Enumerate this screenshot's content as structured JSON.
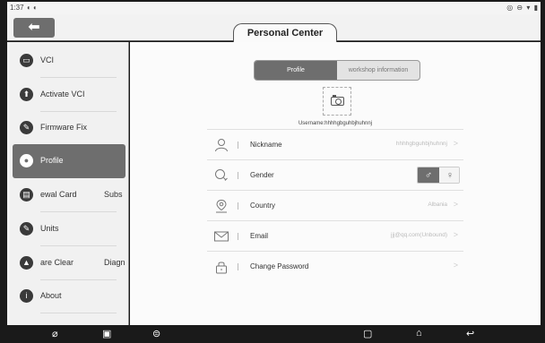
{
  "status": {
    "time": "1:37",
    "left_icons": "◐ ◐",
    "right_icons": "◎ ⊖ ▾ ▮"
  },
  "header": {
    "back_icon": "⬅",
    "title": "Personal Center"
  },
  "sidebar": {
    "items": [
      {
        "label": "VCI",
        "icon": "▭"
      },
      {
        "label": "Activate VCI",
        "icon": "⬆"
      },
      {
        "label": "Firmware Fix",
        "icon": "✎"
      },
      {
        "label": "Profile",
        "icon": "●"
      },
      {
        "label": "ewal Card",
        "label2": "Subs",
        "icon": "▤"
      },
      {
        "label": "Units",
        "icon": "✎"
      },
      {
        "label": "are Clear",
        "label2": "Diagn",
        "icon": "▲"
      },
      {
        "label": "About",
        "icon": "i"
      }
    ]
  },
  "tabs": {
    "profile": "Profile",
    "workshop": "workshop information"
  },
  "username": "Username:hhhhgbguhbjhuhnnj",
  "rows": [
    {
      "label": "Nickname",
      "value": "hhhhgbguhbjhuhnnj",
      "icon": "♙"
    },
    {
      "label": "Gender",
      "value": "",
      "male": "♂",
      "female": "♀",
      "icon": "⚲"
    },
    {
      "label": "Country",
      "value": "Albania",
      "icon": "⊙"
    },
    {
      "label": "Email",
      "value": "jjj@qq.com(Unbound)",
      "icon": "✉"
    },
    {
      "label": "Change Password",
      "value": "",
      "icon": "🔒︎"
    }
  ],
  "chevron": ">",
  "nav": {
    "n1": "⌀",
    "n2": "▣",
    "n3": "⊜",
    "recent": "▢",
    "home": "⌂",
    "back": "↩"
  }
}
